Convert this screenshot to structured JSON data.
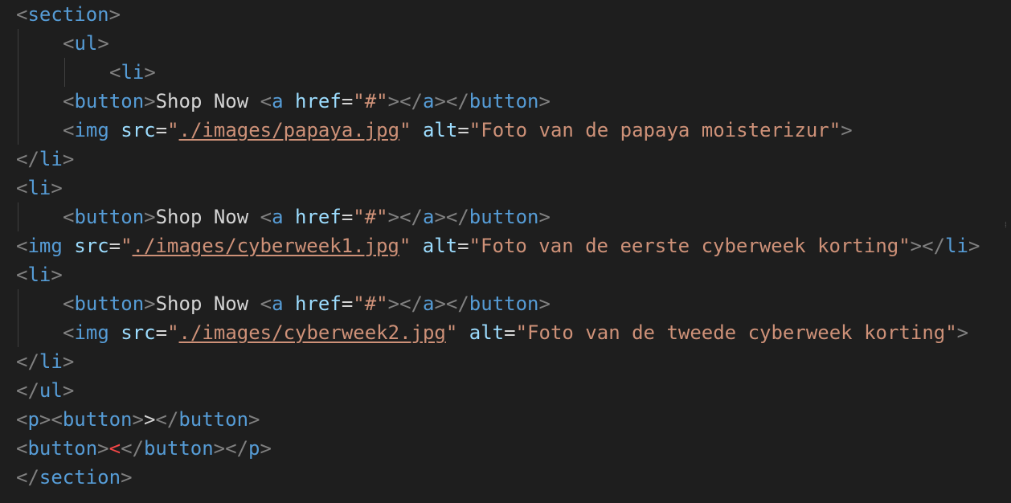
{
  "editor": {
    "tokens": {
      "lt": "<",
      "gt": ">",
      "lt_slash": "</",
      "eq": "=",
      "quote": "\"",
      "space": " "
    },
    "tags": {
      "section": "section",
      "ul": "ul",
      "li": "li",
      "button": "button",
      "a": "a",
      "img": "img",
      "p": "p"
    },
    "attrs": {
      "href": "href",
      "src": "src",
      "alt": "alt"
    },
    "values": {
      "href": "#",
      "src_papaya": "./images/papaya.jpg",
      "alt_papaya": "Foto van de papaya moisterizur",
      "src_cyber1": "./images/cyberweek1.jpg",
      "alt_cyber1": "Foto van de eerste cyberweek korting",
      "src_cyber2": "./images/cyberweek2.jpg",
      "alt_cyber2": "Foto van de tweede cyberweek korting"
    },
    "text": {
      "shop_now": "Shop Now ",
      "next_arrow": ">",
      "prev_arrow": "<"
    },
    "minimap_mark": "⁞"
  }
}
